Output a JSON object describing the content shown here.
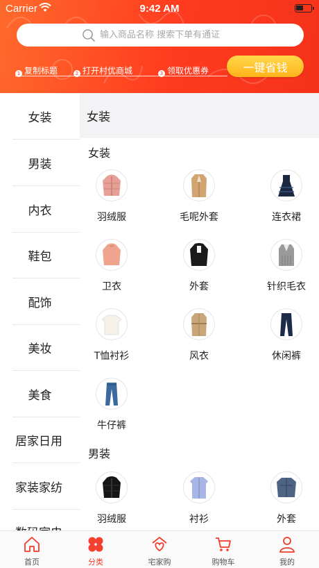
{
  "status_bar": {
    "carrier": "Carrier",
    "time": "9:42 AM",
    "battery_level": 0.5
  },
  "search": {
    "placeholder": "输入商品名称 搜索下单有通证"
  },
  "steps": [
    {
      "num": "1",
      "label": "复制标题"
    },
    {
      "num": "2",
      "label": "打开村优商城"
    },
    {
      "num": "3",
      "label": "领取优惠券"
    }
  ],
  "quick_save_label": "一键省钱",
  "colors": {
    "brand": "#f23c28",
    "accent_button": "#ffc22e"
  },
  "sidebar": {
    "items": [
      {
        "label": "女装",
        "selected": true
      },
      {
        "label": "男装"
      },
      {
        "label": "内衣"
      },
      {
        "label": "鞋包"
      },
      {
        "label": "配饰"
      },
      {
        "label": "美妆"
      },
      {
        "label": "美食"
      },
      {
        "label": "居家日用"
      },
      {
        "label": "家装家纺"
      },
      {
        "label": "数码家电"
      }
    ]
  },
  "content": {
    "header_title": "女装",
    "sections": [
      {
        "title": "女装",
        "items": [
          {
            "label": "羽绒服",
            "icon": "puffer-jacket-icon"
          },
          {
            "label": "毛呢外套",
            "icon": "wool-coat-icon"
          },
          {
            "label": "连衣裙",
            "icon": "dress-icon"
          },
          {
            "label": "卫衣",
            "icon": "hoodie-icon"
          },
          {
            "label": "外套",
            "icon": "jacket-icon"
          },
          {
            "label": "针织毛衣",
            "icon": "knit-sweater-icon"
          },
          {
            "label": "T恤衬衫",
            "icon": "tshirt-icon"
          },
          {
            "label": "风衣",
            "icon": "trench-coat-icon"
          },
          {
            "label": "休闲裤",
            "icon": "casual-pants-icon"
          },
          {
            "label": "牛仔裤",
            "icon": "jeans-icon"
          }
        ]
      },
      {
        "title": "男装",
        "items": [
          {
            "label": "羽绒服",
            "icon": "puffer-jacket-icon"
          },
          {
            "label": "衬衫",
            "icon": "shirt-icon"
          },
          {
            "label": "外套",
            "icon": "denim-jacket-icon"
          }
        ]
      }
    ]
  },
  "tabbar": {
    "items": [
      {
        "label": "首页",
        "icon": "home-icon"
      },
      {
        "label": "分类",
        "icon": "category-icon",
        "active": true
      },
      {
        "label": "宅家购",
        "icon": "house-shop-icon"
      },
      {
        "label": "购物车",
        "icon": "cart-icon"
      },
      {
        "label": "我的",
        "icon": "profile-icon"
      }
    ]
  }
}
